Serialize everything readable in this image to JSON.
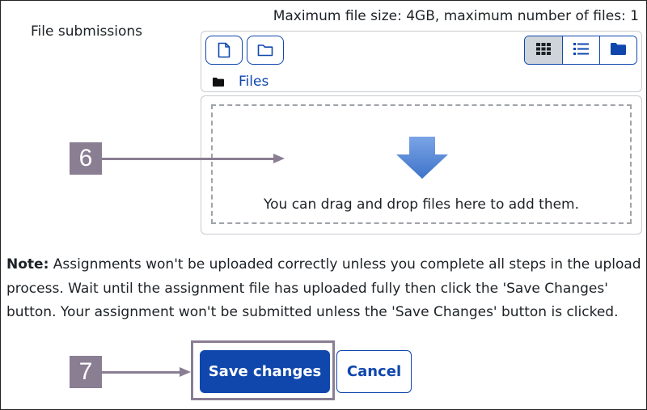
{
  "filepicker": {
    "max_info": "Maximum file size: 4GB, maximum number of files: 1",
    "section_label": "File submissions",
    "toolbar": {
      "add_file_icon": "file-icon",
      "create_folder_icon": "folder-icon",
      "view_icons": [
        "grid-icon",
        "list-icon",
        "folder-tree-icon"
      ],
      "active_view": "grid"
    },
    "path": {
      "folder_icon": "folder-icon",
      "label": "Files"
    },
    "dropzone": {
      "text": "You can drag and drop files here to add them."
    }
  },
  "note": {
    "label": "Note:",
    "text": " Assignments won't be uploaded correctly unless you complete all steps in the upload process. Wait until the assignment file has uploaded fully then click the 'Save Changes' button. Your assignment won't be submitted unless the 'Save Changes' button is clicked."
  },
  "actions": {
    "save_label": "Save changes",
    "cancel_label": "Cancel"
  },
  "callouts": [
    {
      "number": "6"
    },
    {
      "number": "7"
    }
  ],
  "colors": {
    "primary": "#0f47ad",
    "callout": "#8a7e93",
    "active_view_bg": "#ced4da",
    "dropzone_arrow": "#5b8bd6"
  }
}
